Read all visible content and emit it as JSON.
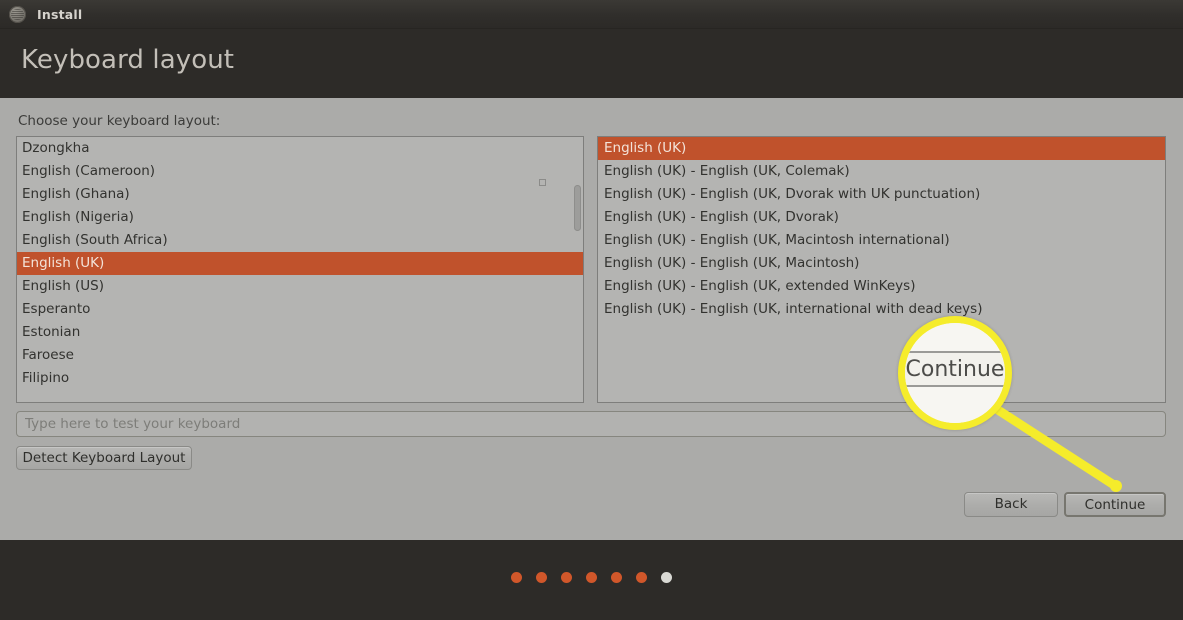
{
  "window": {
    "icon": "ubuntu-circle-icon",
    "title": "Install"
  },
  "header": {
    "page_title": "Keyboard layout"
  },
  "main": {
    "prompt": "Choose your keyboard layout:",
    "left_list": {
      "name": "keyboard-language-list",
      "selected": "English (UK)",
      "items": [
        "Dzongkha",
        "English (Cameroon)",
        "English (Ghana)",
        "English (Nigeria)",
        "English (South Africa)",
        "English (UK)",
        "English (US)",
        "Esperanto",
        "Estonian",
        "Faroese",
        "Filipino"
      ]
    },
    "right_list": {
      "name": "keyboard-variant-list",
      "selected": "English (UK)",
      "items": [
        "English (UK)",
        "English (UK) - English (UK, Colemak)",
        "English (UK) - English (UK, Dvorak with UK punctuation)",
        "English (UK) - English (UK, Dvorak)",
        "English (UK) - English (UK, Macintosh international)",
        "English (UK) - English (UK, Macintosh)",
        "English (UK) - English (UK, extended WinKeys)",
        "English (UK) - English (UK, international with dead keys)"
      ]
    },
    "test_input": {
      "placeholder": "Type here to test your keyboard",
      "value": ""
    },
    "detect_button": "Detect Keyboard Layout"
  },
  "actions": {
    "back": "Back",
    "continue": "Continue"
  },
  "callout": {
    "magnified_label": "Continue",
    "ring_color": "#f5ec2b"
  },
  "footer": {
    "progress_dots": [
      {
        "state": "done"
      },
      {
        "state": "done"
      },
      {
        "state": "done"
      },
      {
        "state": "done"
      },
      {
        "state": "done"
      },
      {
        "state": "done"
      },
      {
        "state": "current"
      }
    ],
    "dot_done_color": "#d1572a",
    "dot_current_color": "#d9d9d4"
  },
  "colors": {
    "selection": "#c0522c",
    "header_bg": "#2d2b28",
    "body_bg": "#ababa9",
    "list_bg": "#b4b4b2"
  }
}
